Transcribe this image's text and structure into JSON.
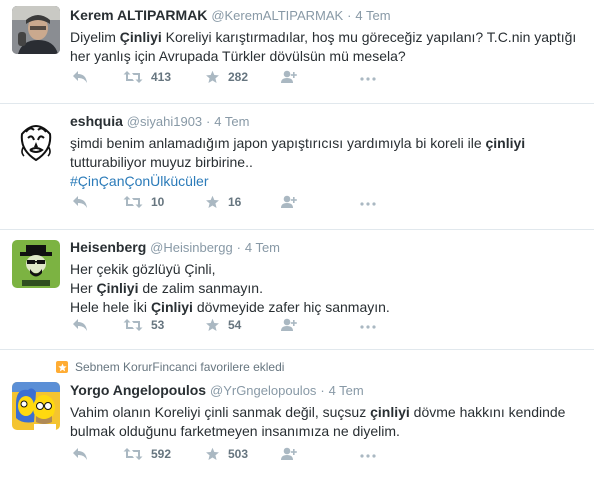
{
  "tweets": [
    {
      "fullname": "Kerem ALTIPARMAK",
      "username": "@KeremALTIPARMAK",
      "dot": "·",
      "time": "4 Tem",
      "line1_a": "Diyelim ",
      "line1_b": "Çinliyi",
      "line1_c": " Koreliyi karıştırmadılar, hoş mu göreceğiz yapılanı? T.C.nin yaptığı",
      "line2": "her yanlış için Avrupada Türkler dövülsün mü mesela?",
      "retweets": "413",
      "favorites": "282"
    },
    {
      "fullname": "eshquia",
      "username": "@siyahi1903",
      "dot": "·",
      "time": "4 Tem",
      "line1_a": "şimdi benim anlamadığım japon yapıştırıcısı yardımıyla bi koreli ile ",
      "line1_b": "çinliyi",
      "line2": "tutturabiliyor muyuz birbirine..",
      "hashtag": "#ÇinÇanÇonÜlkücüler",
      "retweets": "10",
      "favorites": "16"
    },
    {
      "fullname": "Heisenberg",
      "username": "@Heisinbergg",
      "dot": "·",
      "time": "4 Tem",
      "line1": "Her çekik gözlüyü Çinli,",
      "line2_a": "Her ",
      "line2_b": "Çinliyi",
      "line2_c": " de zalim sanmayın.",
      "line3_a": "Hele hele İki ",
      "line3_b": "Çinliyi",
      "line3_c": " dövmeyide zafer hiç sanmayın.",
      "retweets": "53",
      "favorites": "54"
    },
    {
      "context": "Sebnem KorurFincanci favorilere ekledi",
      "fullname": "Yorgo Angelopoulos",
      "username": "@YrGngelopoulos",
      "dot": "·",
      "time": "4 Tem",
      "line1_a": "Vahim olanın Koreliyi çinli sanmak değil, suçsuz ",
      "line1_b": "çinliyi",
      "line1_c": " dövme hakkını kendinde",
      "line2": "bulmak olduğunu farketmeyen insanımıza ne diyelim.",
      "retweets": "592",
      "favorites": "503"
    }
  ],
  "colors": {
    "link": "#2b7bb9",
    "icon": "#aab8c2",
    "divider": "#e1e8ed",
    "retweet_hover": "#19cf86",
    "favorite_badge": "#ffac33"
  }
}
